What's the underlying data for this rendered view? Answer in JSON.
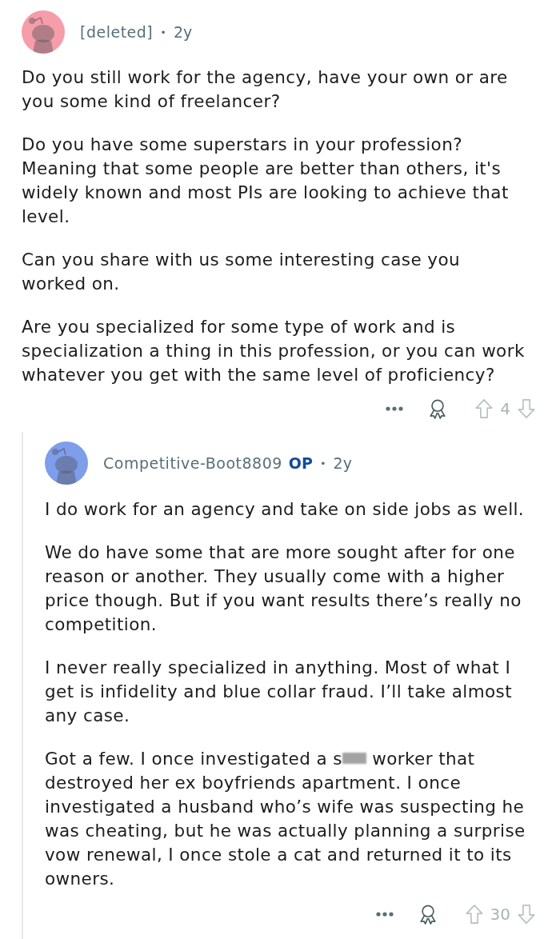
{
  "comment": {
    "author": "[deleted]",
    "separator": "•",
    "age": "2y",
    "avatar": {
      "color": "#f59da8"
    },
    "paragraphs": [
      [
        {
          "kind": "text",
          "text": "Do you still work for the agency, have your own or are you some kind of freelancer?"
        }
      ],
      [
        {
          "kind": "text",
          "text": "Do you have some superstars in your profession? Meaning that some people are better than others, it's widely known and most PIs are looking to achieve that level."
        }
      ],
      [
        {
          "kind": "text",
          "text": "Can you share with us some interesting case you worked on."
        }
      ],
      [
        {
          "kind": "text",
          "text": "Are you specialized for some type of work and is specialization a thing in this profession, or you can work whatever you get with the same level of proficiency?"
        }
      ]
    ],
    "score": "4",
    "replies": [
      {
        "author": "Competitive-Boot8809",
        "flair": "OP",
        "separator": "•",
        "age": "2y",
        "avatar": {
          "color": "#7e9deb"
        },
        "paragraphs": [
          [
            {
              "kind": "text",
              "text": "I do work for an agency and take on side jobs as well."
            }
          ],
          [
            {
              "kind": "text",
              "text": "We do have some that are more sought after for one reason or another. They usually come with a higher price though. But if you want results there’s really no competition."
            }
          ],
          [
            {
              "kind": "text",
              "text": "I never really specialized in anything. Most of what I get is infidelity and blue collar fraud. I’ll take almost any case."
            }
          ],
          [
            {
              "kind": "text",
              "text": "Got a few. I once investigated a s"
            },
            {
              "kind": "redaction"
            },
            {
              "kind": "text",
              "text": " worker that destroyed her ex boyfriends apartment. I once investigated a husband who’s wife was suspecting he was cheating, but he was actually planning a surprise vow renewal, I once stole a cat and returned it to its owners."
            }
          ]
        ],
        "score": "30"
      }
    ]
  }
}
